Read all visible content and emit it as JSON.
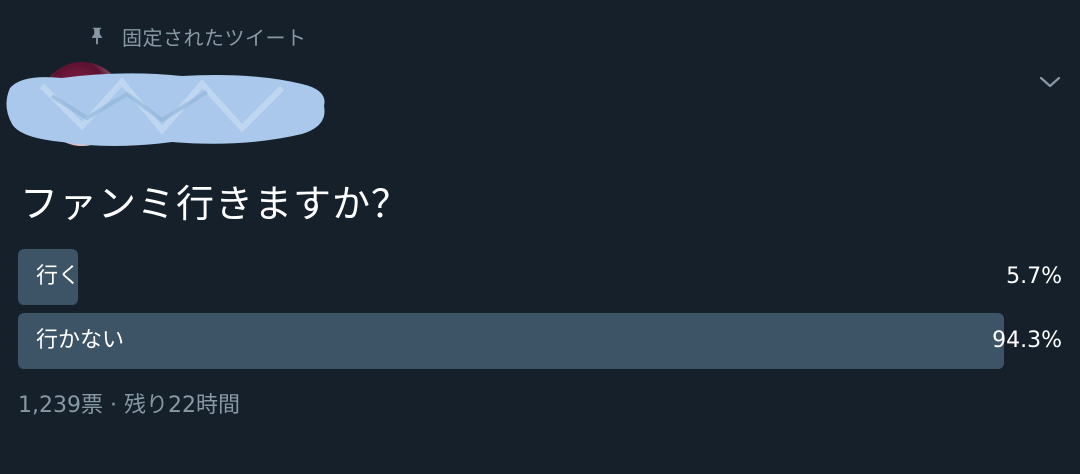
{
  "tweet": {
    "pinned_label": "固定されたツイート",
    "icons": {
      "pin": "pin-icon",
      "caret": "chevron-down-icon"
    }
  },
  "poll": {
    "question": "ファンミ行きますか？",
    "options": [
      {
        "label": "行く",
        "percent_text": "5.7%",
        "percent": 5.7
      },
      {
        "label": "行かない",
        "percent_text": "94.3%",
        "percent": 94.3
      }
    ],
    "votes_text": "1,239票",
    "separator": "·",
    "remaining_text": "残り22時間"
  },
  "colors": {
    "background": "#15202b",
    "bar": "#3d5466",
    "secondary_text": "#8899a6",
    "primary_text": "#ffffff",
    "redaction": "#a9c8ec"
  }
}
